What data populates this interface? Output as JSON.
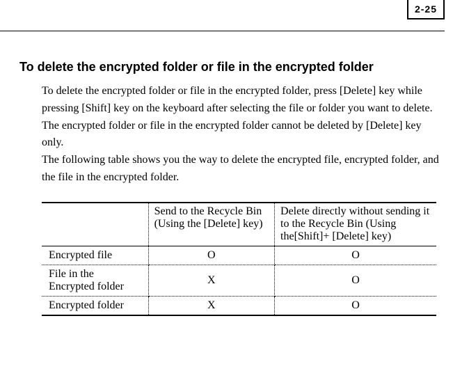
{
  "page_number": "2-25",
  "section_title": "To delete the encrypted folder or file in the encrypted folder",
  "paragraph1": "To delete the encrypted folder or file in the encrypted folder, press [Delete] key while pressing [Shift] key on the keyboard after selecting the file or folder you want to delete. The encrypted folder or file in the encrypted folder cannot be deleted by [Delete] key only.",
  "paragraph2": "The following table shows you the way to delete the encrypted file, encrypted folder, and the file in the encrypted folder.",
  "chart_data": {
    "type": "table",
    "columns": [
      "",
      "Send to the Recycle Bin (Using the [Delete] key)",
      "Delete directly without sending it to the Recycle Bin (Using the[Shift]+ [Delete] key)"
    ],
    "rows": [
      {
        "label": "Encrypted file",
        "recycle": "O",
        "direct": "O"
      },
      {
        "label": "File in the Encrypted folder",
        "recycle": "X",
        "direct": "O"
      },
      {
        "label": "Encrypted folder",
        "recycle": "X",
        "direct": "O"
      }
    ]
  }
}
